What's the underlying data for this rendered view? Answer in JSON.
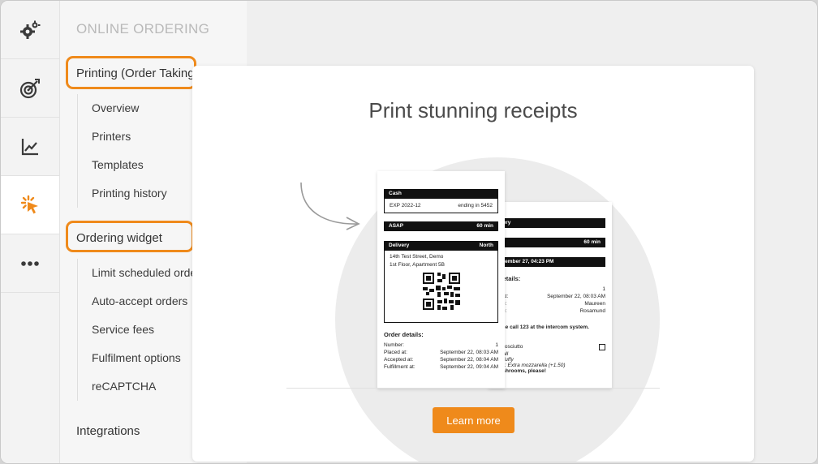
{
  "colors": {
    "accent": "#ef8a1b",
    "rail_bg": "#f3f3f3",
    "nav_bg": "#f6f6f6"
  },
  "rail": {
    "items": [
      {
        "icon": "gears-icon"
      },
      {
        "icon": "target-icon"
      },
      {
        "icon": "chart-line-icon"
      },
      {
        "icon": "cursor-click-icon",
        "active": true
      },
      {
        "icon": "more-dots-icon"
      }
    ]
  },
  "nav": {
    "section_title": "ONLINE ORDERING",
    "printing": {
      "label": "Printing (Order Taking",
      "items": [
        "Overview",
        "Printers",
        "Templates",
        "Printing history"
      ]
    },
    "ordering_widget": {
      "label": "Ordering widget",
      "items": [
        "Limit scheduled orde",
        "Auto-accept orders",
        "Service fees",
        "Fulfilment options",
        "reCAPTCHA"
      ]
    },
    "integrations": "Integrations"
  },
  "card": {
    "title": "Print stunning receipts",
    "button": "Learn more"
  },
  "receipt_front": {
    "payment_bar": "Cash",
    "exp": "EXP 2022-12",
    "ending": "ending in 5452",
    "asap": "ASAP",
    "asap_time": "60 min",
    "delivery": "Delivery",
    "delivery_dir": "North",
    "address1": "14th Test Street, Demo",
    "address2": "1st Floor, Apartment 5B",
    "order_details": "Order details:",
    "rows": [
      {
        "k": "Number:",
        "v": "1"
      },
      {
        "k": "Placed at:",
        "v": "September 22, 08:03 AM"
      },
      {
        "k": "Accepted at:",
        "v": "September 22, 08:04 AM"
      },
      {
        "k": "Fulfillment at:",
        "v": "September 22, 09:04 AM"
      }
    ]
  },
  "receipt_back": {
    "bar1": "very",
    "bar2": "P",
    "bar2_time": "60 min",
    "bar3": "ptember 27, 04:23 PM",
    "details": "r details:",
    "rows": [
      {
        "k": "r:",
        "v": "1"
      },
      {
        "k": "ed at:",
        "v": "September 22, 08:03 AM"
      },
      {
        "k": "ame:",
        "v": "Maureen"
      },
      {
        "k": "ame:",
        "v": "Rosamund"
      }
    ],
    "note": "lease call 123 at the intercom system.",
    "item": "a Prosciutto",
    "mod1": "Small",
    "mod2": "s: Fluffy",
    "mod3": "ings: Extra mozzarella (+1.50)",
    "mod4": "mashrooms, please!"
  }
}
